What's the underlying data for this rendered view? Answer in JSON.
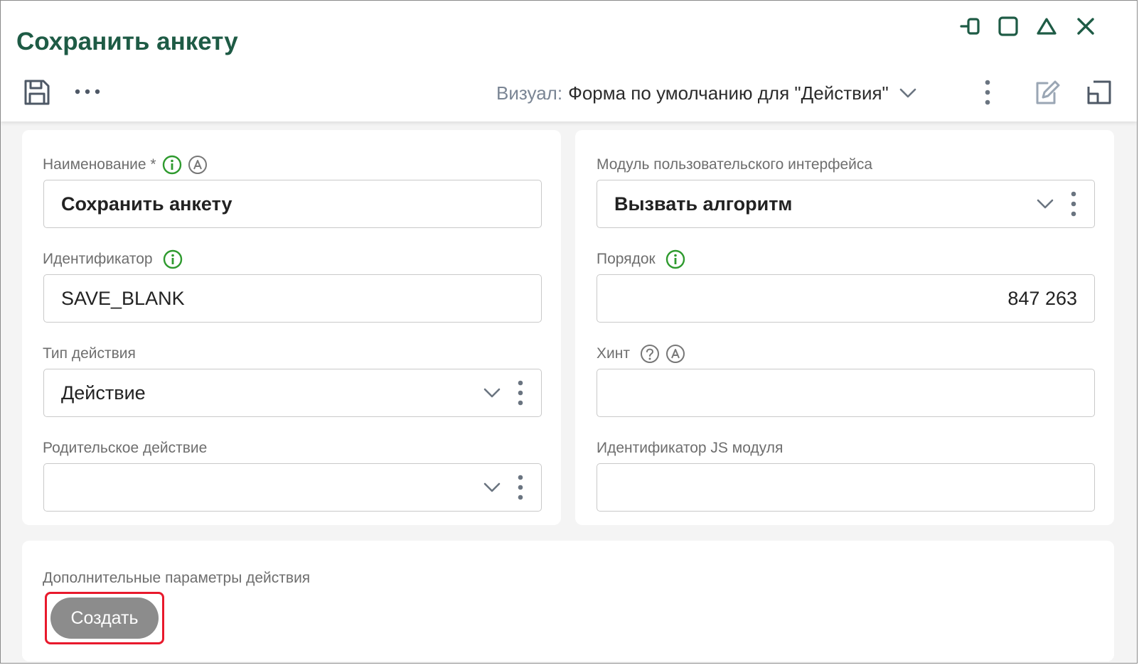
{
  "window": {
    "title": "Сохранить анкету",
    "controls": [
      {
        "name": "pin-icon"
      },
      {
        "name": "maximize-icon"
      },
      {
        "name": "collapse-icon"
      },
      {
        "name": "close-icon"
      }
    ]
  },
  "toolbar": {
    "visual_label": "Визуал:",
    "visual_value": "Форма по умолчанию для \"Действия\"",
    "icons": [
      "save-icon",
      "more-horizontal-icon",
      "chevron-down-icon",
      "more-vertical-icon",
      "edit-icon",
      "layout-icon"
    ]
  },
  "form": {
    "name": {
      "label": "Наименование *",
      "value": "Сохранить анкету",
      "icons": [
        "info-icon",
        "auto-translate-icon"
      ]
    },
    "identifier": {
      "label": "Идентификатор",
      "value": "SAVE_BLANK",
      "icons": [
        "info-icon"
      ]
    },
    "action_type": {
      "label": "Тип действия",
      "value": "Действие"
    },
    "parent_action": {
      "label": "Родительское действие",
      "value": ""
    },
    "ui_module": {
      "label": "Модуль пользовательского интерфейса",
      "value": "Вызвать алгоритм"
    },
    "order": {
      "label": "Порядок",
      "value": "847 263",
      "icons": [
        "info-icon"
      ]
    },
    "hint": {
      "label": "Хинт",
      "value": "",
      "icons": [
        "help-icon",
        "auto-translate-icon"
      ]
    },
    "js_module": {
      "label": "Идентификатор JS модуля",
      "value": ""
    }
  },
  "extra": {
    "label": "Дополнительные параметры действия",
    "create_button": "Создать"
  },
  "colors": {
    "title": "#1e5b45",
    "info_icon": "#2e9a2e",
    "highlight": "#e8192c",
    "create_button": "#8c8c8c"
  }
}
